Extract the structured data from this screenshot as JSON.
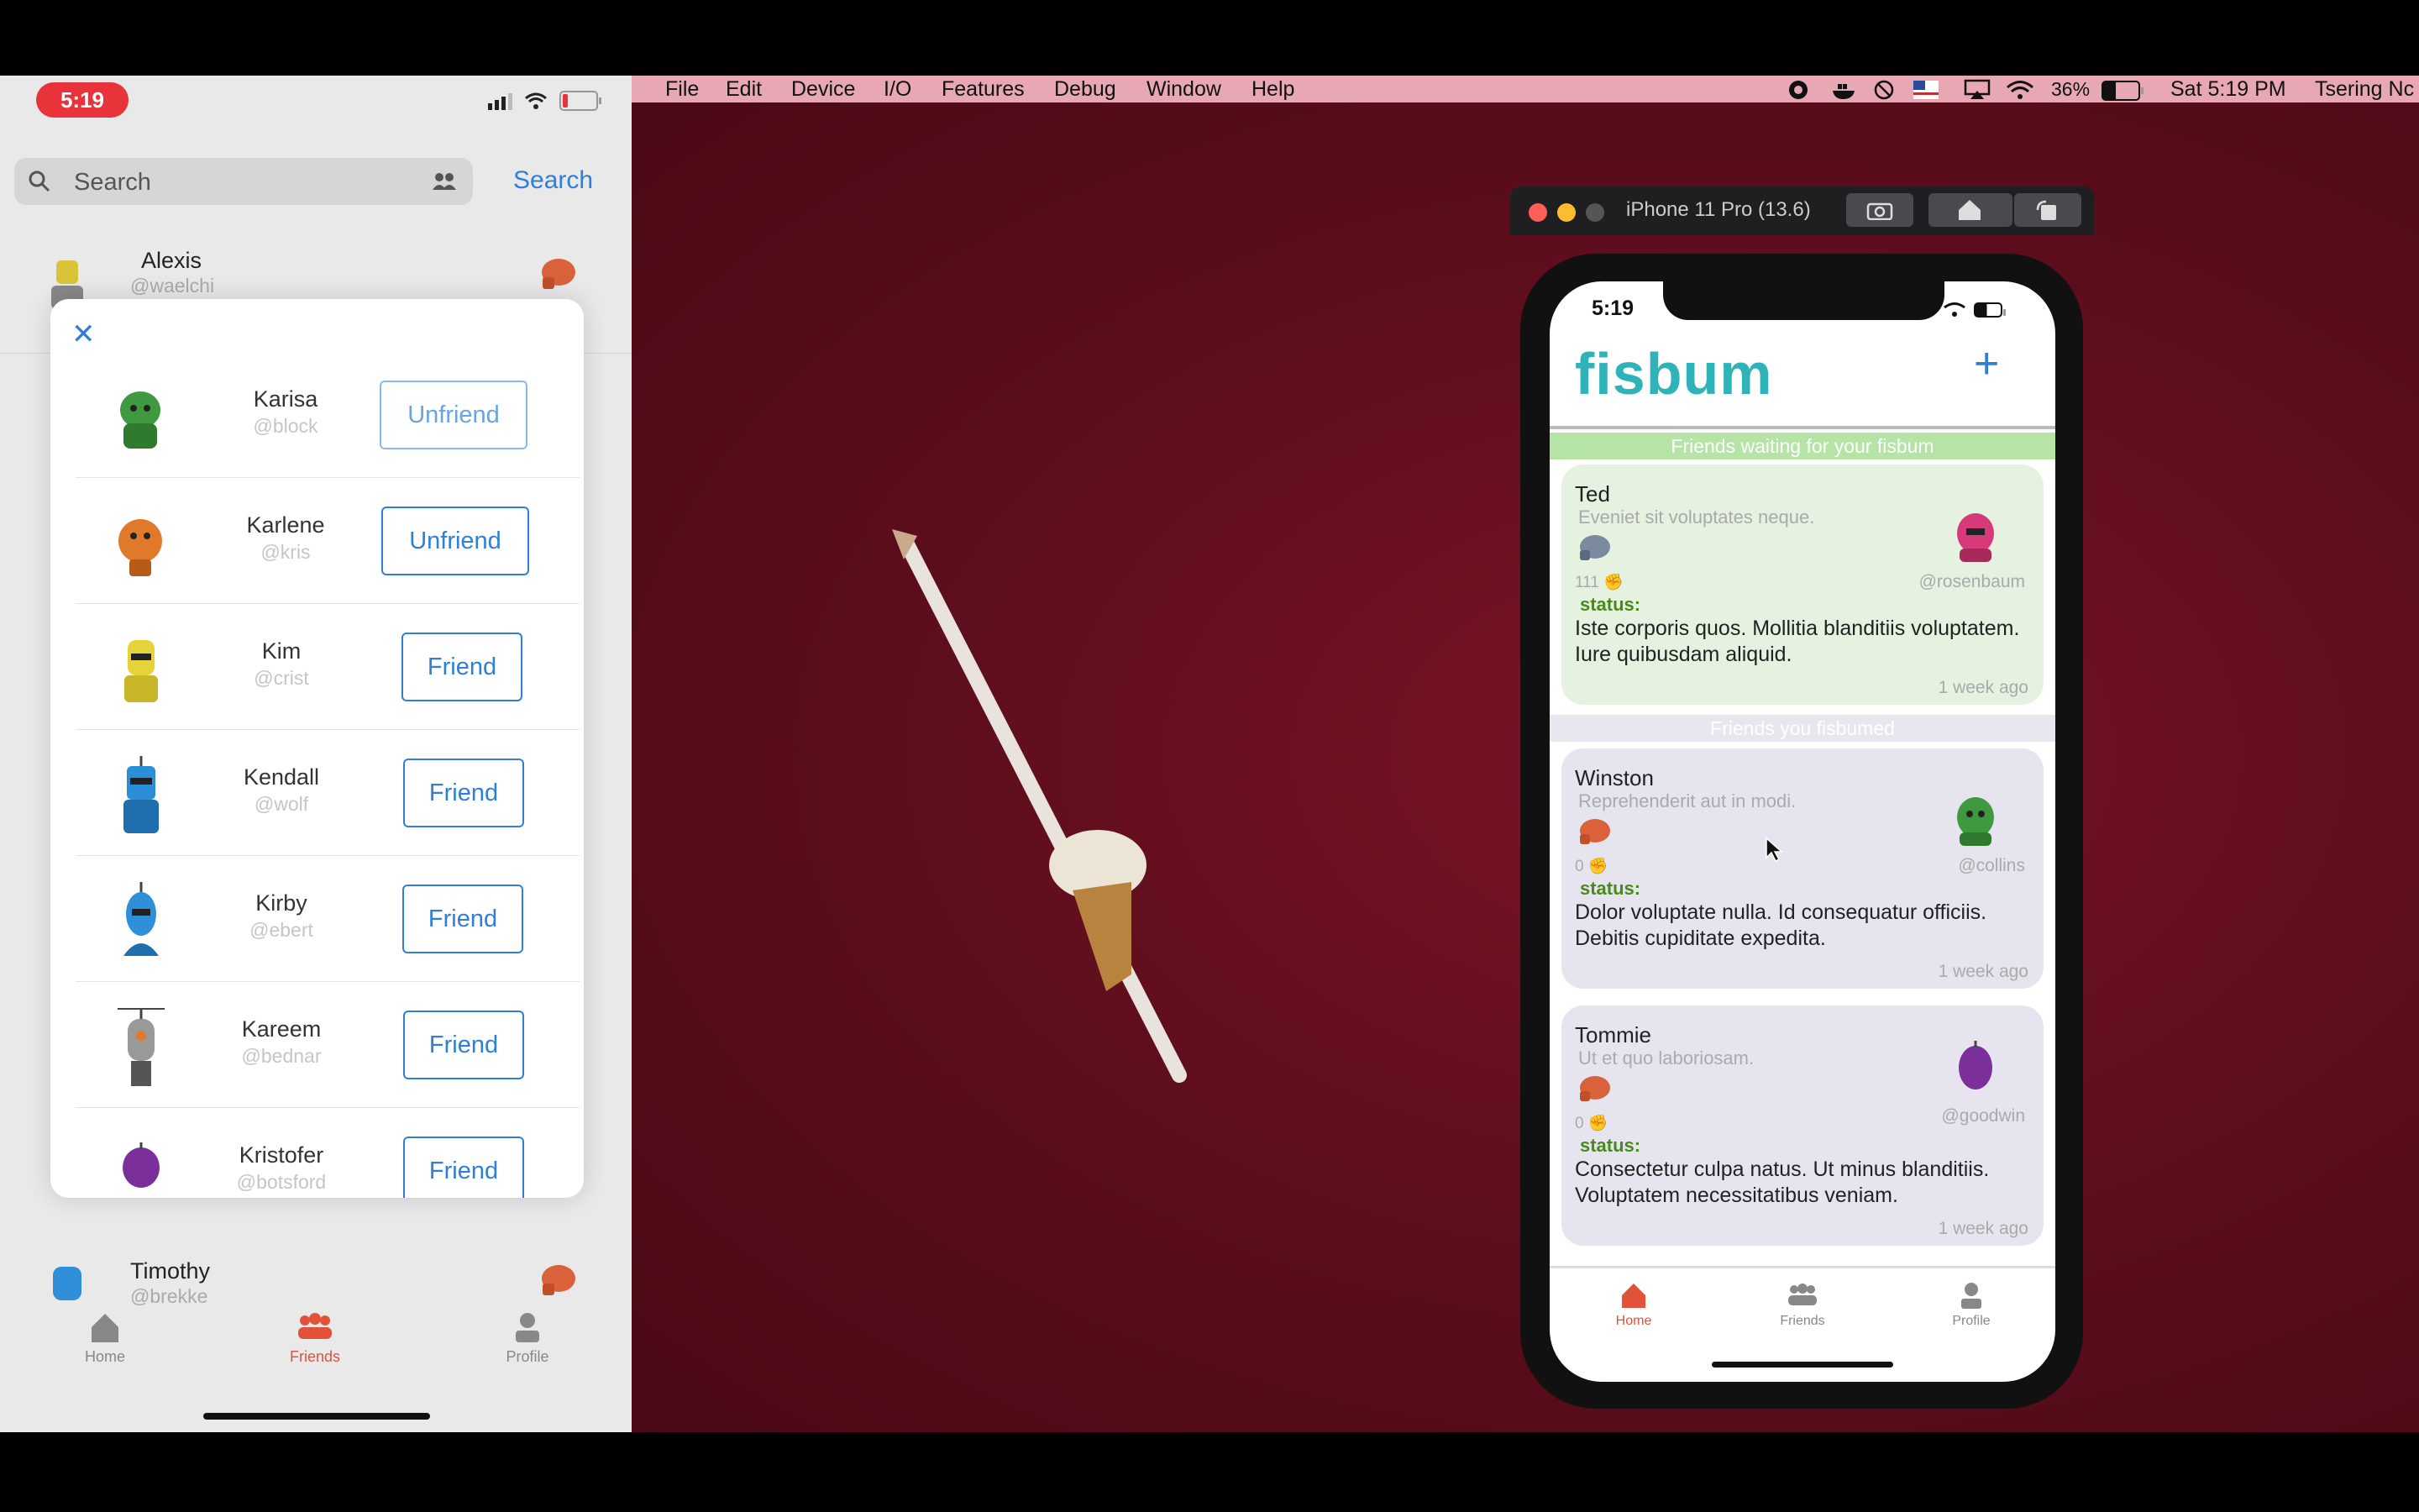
{
  "left_phone": {
    "time": "5:19",
    "search": {
      "placeholder": "Search",
      "button": "Search"
    },
    "list": [
      {
        "name": "Alexis",
        "handle": "@waelchi"
      },
      {
        "name": "Timothy",
        "handle": "@brekke"
      }
    ],
    "modal": {
      "close": "✕",
      "rows": [
        {
          "name": "Karisa",
          "handle": "@block",
          "action": "Unfriend",
          "color": "#3f9a3f"
        },
        {
          "name": "Karlene",
          "handle": "@kris",
          "action": "Unfriend",
          "color": "#e07a2a"
        },
        {
          "name": "Kim",
          "handle": "@crist",
          "action": "Friend",
          "color": "#e6d33a"
        },
        {
          "name": "Kendall",
          "handle": "@wolf",
          "action": "Friend",
          "color": "#2a8fd6"
        },
        {
          "name": "Kirby",
          "handle": "@ebert",
          "action": "Friend",
          "color": "#2f8fd8"
        },
        {
          "name": "Kareem",
          "handle": "@bednar",
          "action": "Friend",
          "color": "#888888"
        },
        {
          "name": "Kristofer",
          "handle": "@botsford",
          "action": "Friend",
          "color": "#7a2f9a"
        }
      ]
    },
    "tabs": [
      {
        "label": "Home",
        "icon": "house-icon"
      },
      {
        "label": "Friends",
        "icon": "people-icon"
      },
      {
        "label": "Profile",
        "icon": "person-icon"
      }
    ]
  },
  "menubar": {
    "items": [
      "File",
      "Edit",
      "Device",
      "I/O",
      "Features",
      "Debug",
      "Window",
      "Help"
    ],
    "battery": "36%",
    "clock": "Sat 5:19 PM",
    "user": "Tsering Nc"
  },
  "simulator": {
    "title": "iPhone 11 Pro (13.6)",
    "time": "5:19",
    "app_title": "fisbum",
    "add": "+",
    "section_waiting": "Friends waiting for your fisbum",
    "section_sent": "Friends you fisbumed",
    "cards": [
      {
        "name": "Ted",
        "sub": "Eveniet sit voluptates neque.",
        "count": "111",
        "status_label": "status:",
        "body": "Iste corporis quos. Mollitia blanditiis voluptatem. Iure quibusdam aliquid.",
        "time": "1 week ago",
        "handle": "@rosenbaum"
      },
      {
        "name": "Winston",
        "sub": "Reprehenderit aut in modi.",
        "count": "0",
        "status_label": "status:",
        "body": "Dolor voluptate nulla. Id consequatur officiis. Debitis cupiditate expedita.",
        "time": "1 week ago",
        "handle": "@collins"
      },
      {
        "name": "Tommie",
        "sub": "Ut et quo laboriosam.",
        "count": "0",
        "status_label": "status:",
        "body": "Consectetur culpa natus. Ut minus blanditiis. Voluptatem necessitatibus veniam.",
        "time": "1 week ago",
        "handle": "@goodwin"
      }
    ],
    "tabs": [
      {
        "label": "Home"
      },
      {
        "label": "Friends"
      },
      {
        "label": "Profile"
      }
    ]
  },
  "colors": {
    "accent": "#2f7fd8",
    "active_tab": "#e0533a",
    "brand": "#2fb3b8",
    "waiting_bg": "#e4f2df",
    "sent_bg": "#e6e4ee"
  }
}
